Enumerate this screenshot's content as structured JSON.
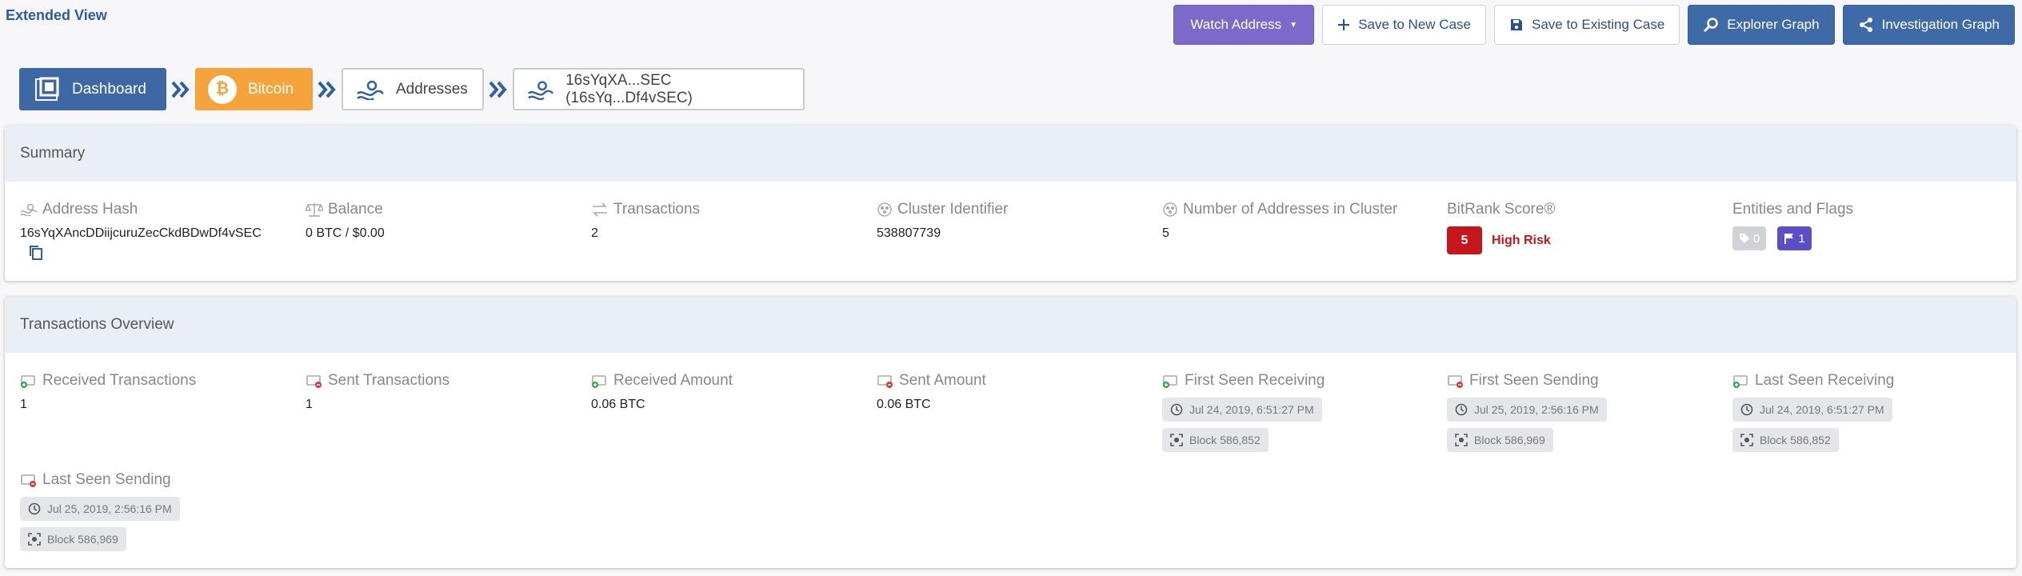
{
  "view_title": "Extended View",
  "actions": {
    "watch": "Watch Address",
    "save_new": "Save to New Case",
    "save_existing": "Save to Existing Case",
    "explorer": "Explorer Graph",
    "investigation": "Investigation Graph"
  },
  "breadcrumb": {
    "dashboard": "Dashboard",
    "bitcoin": "Bitcoin",
    "bitcoin_symbol": "₿",
    "addresses": "Addresses",
    "current": "16sYqXA...SEC (16sYq...Df4vSEC)"
  },
  "summary": {
    "title": "Summary",
    "address_hash_label": "Address Hash",
    "address_hash": "16sYqXAncDDiijcuruZecCkdBDwDf4vSEC",
    "balance_label": "Balance",
    "balance": "0 BTC / $0.00",
    "transactions_label": "Transactions",
    "transactions": "2",
    "cluster_label": "Cluster Identifier",
    "cluster": "538807739",
    "num_addresses_label": "Number of Addresses in Cluster",
    "num_addresses": "5",
    "bitrank_label": "BitRank Score®",
    "bitrank_score": "5",
    "bitrank_risk": "High Risk",
    "flags_label": "Entities and Flags",
    "tag_count": "0",
    "flag_count": "1"
  },
  "overview": {
    "title": "Transactions Overview",
    "received_tx_label": "Received Transactions",
    "received_tx": "1",
    "sent_tx_label": "Sent Transactions",
    "sent_tx": "1",
    "received_amount_label": "Received Amount",
    "received_amount": "0.06 BTC",
    "sent_amount_label": "Sent Amount",
    "sent_amount": "0.06 BTC",
    "first_recv_label": "First Seen Receiving",
    "first_recv_time": "Jul 24, 2019, 6:51:27 PM",
    "first_recv_block": "Block 586,852",
    "first_send_label": "First Seen Sending",
    "first_send_time": "Jul 25, 2019, 2:56:16 PM",
    "first_send_block": "Block 586,969",
    "last_recv_label": "Last Seen Receiving",
    "last_recv_time": "Jul 24, 2019, 6:51:27 PM",
    "last_recv_block": "Block 586,852",
    "last_send_label": "Last Seen Sending",
    "last_send_time": "Jul 25, 2019, 2:56:16 PM",
    "last_send_block": "Block 586,969"
  },
  "colors": {
    "primary_blue": "#3e68a5",
    "purple": "#7c69c9",
    "orange": "#f5a33b",
    "risk_red": "#c4161c"
  }
}
